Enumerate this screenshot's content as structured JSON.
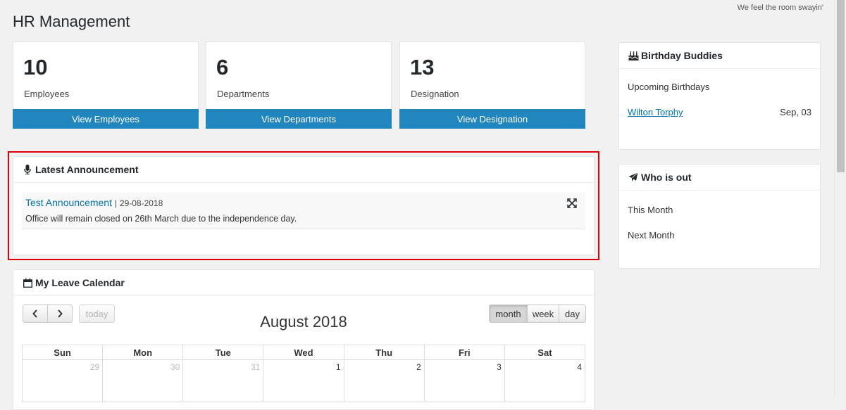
{
  "topbar": {
    "message": "We feel the room swayin'"
  },
  "page": {
    "title": "HR Management"
  },
  "stats": [
    {
      "count": "10",
      "label": "Employees",
      "button": "View Employees"
    },
    {
      "count": "6",
      "label": "Departments",
      "button": "View Departments"
    },
    {
      "count": "13",
      "label": "Designation",
      "button": "View Designation"
    }
  ],
  "announcement": {
    "heading": "Latest Announcement",
    "items": [
      {
        "title": "Test Announcement",
        "separator": "|",
        "date": "29-08-2018",
        "body": "Office will remain closed on 26th March due to the independence day."
      }
    ]
  },
  "birthday": {
    "heading": "Birthday Buddies",
    "subheading": "Upcoming Birthdays",
    "items": [
      {
        "name": "Wilton Torphy",
        "date": "Sep, 03"
      }
    ]
  },
  "who_is_out": {
    "heading": "Who is out",
    "this_month": "This Month",
    "next_month": "Next Month"
  },
  "calendar": {
    "heading": "My Leave Calendar",
    "prev": "‹",
    "next": "›",
    "today": "today",
    "title": "August 2018",
    "views": [
      "month",
      "week",
      "day"
    ],
    "active_view": "month",
    "weekdays": [
      "Sun",
      "Mon",
      "Tue",
      "Wed",
      "Thu",
      "Fri",
      "Sat"
    ],
    "first_row": [
      {
        "day": "29",
        "other": true
      },
      {
        "day": "30",
        "other": true
      },
      {
        "day": "31",
        "other": true
      },
      {
        "day": "1",
        "other": false
      },
      {
        "day": "2",
        "other": false
      },
      {
        "day": "3",
        "other": false
      },
      {
        "day": "4",
        "other": false
      }
    ]
  },
  "colors": {
    "accent": "#2185be",
    "link": "#0073aa",
    "highlight": "#e00000"
  }
}
